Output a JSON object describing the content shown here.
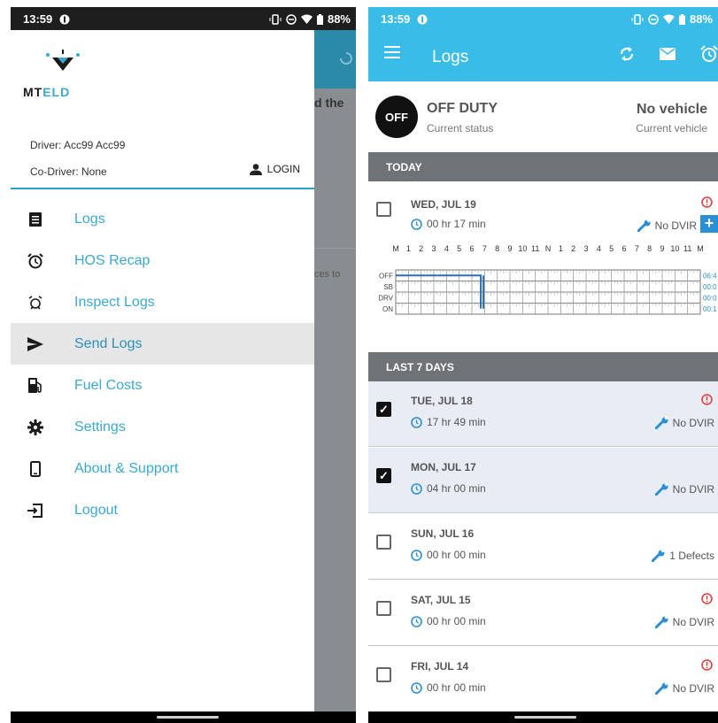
{
  "left": {
    "status_bar": {
      "time": "13:59",
      "battery": "88%"
    },
    "brand": {
      "name_part1": "MT",
      "name_part2": "ELD"
    },
    "driver": "Driver: Acc99 Acc99",
    "codriver": "Co-Driver: None",
    "login_label": "LOGIN",
    "behind": {
      "text1": "d the",
      "text2": "ces to"
    },
    "menu": [
      {
        "label": "Logs",
        "icon": "list-icon"
      },
      {
        "label": "HOS Recap",
        "icon": "alarm-clock-icon"
      },
      {
        "label": "Inspect Logs",
        "icon": "inspect-icon"
      },
      {
        "label": "Send Logs",
        "icon": "send-icon",
        "active": true
      },
      {
        "label": "Fuel Costs",
        "icon": "fuel-icon"
      },
      {
        "label": "Settings",
        "icon": "gear-icon"
      },
      {
        "label": "About & Support",
        "icon": "phone-icon"
      },
      {
        "label": "Logout",
        "icon": "logout-icon"
      }
    ]
  },
  "right": {
    "status_bar": {
      "time": "13:59",
      "battery": "88%"
    },
    "appbar": {
      "title": "Logs"
    },
    "current_status": {
      "badge": "OFF",
      "title": "OFF DUTY",
      "subtitle": "Current status"
    },
    "current_vehicle": {
      "title": "No vehicle",
      "subtitle": "Current vehicle"
    },
    "today_header": "TODAY",
    "today": {
      "date": "WED, JUL 19",
      "duration": "00 hr  17 min",
      "dvir": "No DVIR",
      "graph": {
        "hour_labels": [
          "M",
          "1",
          "2",
          "3",
          "4",
          "5",
          "6",
          "7",
          "8",
          "9",
          "10",
          "11",
          "N",
          "1",
          "2",
          "3",
          "4",
          "5",
          "6",
          "7",
          "8",
          "9",
          "10",
          "11",
          "M"
        ],
        "row_labels": [
          "OFF",
          "SB",
          "DRV",
          "ON"
        ],
        "totals": [
          "06:4",
          "00:0",
          "00:0",
          "00:1"
        ]
      }
    },
    "last7_header": "LAST 7 DAYS",
    "days": [
      {
        "date": "TUE, JUL 18",
        "duration": "17 hr  49 min",
        "dvir": "No DVIR",
        "checked": true,
        "warn": true
      },
      {
        "date": "MON, JUL 17",
        "duration": "04 hr  00 min",
        "dvir": "No DVIR",
        "checked": true,
        "warn": false
      },
      {
        "date": "SUN, JUL 16",
        "duration": "00 hr  00 min",
        "dvir": "1 Defects",
        "checked": false,
        "warn": false
      },
      {
        "date": "SAT, JUL 15",
        "duration": "00 hr  00 min",
        "dvir": "No DVIR",
        "checked": false,
        "warn": true
      },
      {
        "date": "FRI, JUL 14",
        "duration": "00 hr  00 min",
        "dvir": "No DVIR",
        "checked": false,
        "warn": true
      }
    ]
  }
}
